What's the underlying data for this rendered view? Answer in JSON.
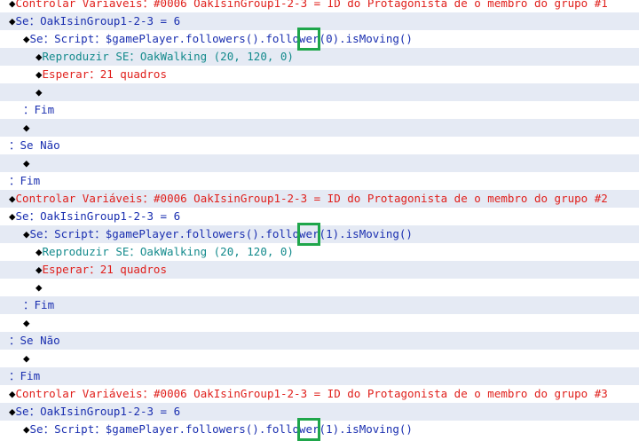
{
  "rows": [
    {
      "indent": 0,
      "marker": "◆",
      "cls": "red",
      "text": "Controlar Variáveis：#0006 OakIsinGroup1-2-3 = ID do Protagonista de o membro do grupo #1"
    },
    {
      "indent": 0,
      "marker": "◆",
      "cls": "blue",
      "text": "Se：OakIsinGroup1-2-3 = 6"
    },
    {
      "indent": 1,
      "marker": "◆",
      "cls": "blue",
      "text": "Se：Script：$gamePlayer.followers().follower(0).isMoving()"
    },
    {
      "indent": 2,
      "marker": "◆",
      "cls": "teal",
      "text": "Reproduzir SE：OakWalking (20, 120, 0)"
    },
    {
      "indent": 2,
      "marker": "◆",
      "cls": "red",
      "text": "Esperar：21 quadros"
    },
    {
      "indent": 2,
      "marker": "◆",
      "cls": "plain",
      "text": ""
    },
    {
      "indent": 1,
      "marker": "：",
      "cls": "plain",
      "text": "Fim"
    },
    {
      "indent": 1,
      "marker": "◆",
      "cls": "plain",
      "text": ""
    },
    {
      "indent": 0,
      "marker": "：",
      "cls": "plain",
      "text": "Se Não"
    },
    {
      "indent": 1,
      "marker": "◆",
      "cls": "plain",
      "text": ""
    },
    {
      "indent": 0,
      "marker": "：",
      "cls": "plain",
      "text": "Fim"
    },
    {
      "indent": 0,
      "marker": "◆",
      "cls": "red",
      "text": "Controlar Variáveis：#0006 OakIsinGroup1-2-3 = ID do Protagonista de o membro do grupo #2"
    },
    {
      "indent": 0,
      "marker": "◆",
      "cls": "blue",
      "text": "Se：OakIsinGroup1-2-3 = 6"
    },
    {
      "indent": 1,
      "marker": "◆",
      "cls": "blue",
      "text": "Se：Script：$gamePlayer.followers().follower(1).isMoving()"
    },
    {
      "indent": 2,
      "marker": "◆",
      "cls": "teal",
      "text": "Reproduzir SE：OakWalking (20, 120, 0)"
    },
    {
      "indent": 2,
      "marker": "◆",
      "cls": "red",
      "text": "Esperar：21 quadros"
    },
    {
      "indent": 2,
      "marker": "◆",
      "cls": "plain",
      "text": ""
    },
    {
      "indent": 1,
      "marker": "：",
      "cls": "plain",
      "text": "Fim"
    },
    {
      "indent": 1,
      "marker": "◆",
      "cls": "plain",
      "text": ""
    },
    {
      "indent": 0,
      "marker": "：",
      "cls": "plain",
      "text": "Se Não"
    },
    {
      "indent": 1,
      "marker": "◆",
      "cls": "plain",
      "text": ""
    },
    {
      "indent": 0,
      "marker": "：",
      "cls": "plain",
      "text": "Fim"
    },
    {
      "indent": 0,
      "marker": "◆",
      "cls": "red",
      "text": "Controlar Variáveis：#0006 OakIsinGroup1-2-3 = ID do Protagonista de o membro do grupo #3"
    },
    {
      "indent": 0,
      "marker": "◆",
      "cls": "blue",
      "text": "Se：OakIsinGroup1-2-3 = 6"
    },
    {
      "indent": 1,
      "marker": "◆",
      "cls": "blue",
      "text": "Se：Script：$gamePlayer.followers().follower(1).isMoving()"
    }
  ],
  "colors": {
    "command": "#e0201c",
    "condition": "#1a2fb0",
    "sound": "#138a8c",
    "highlight": "#1fa64b",
    "alt_row": "#e5eaf4"
  }
}
